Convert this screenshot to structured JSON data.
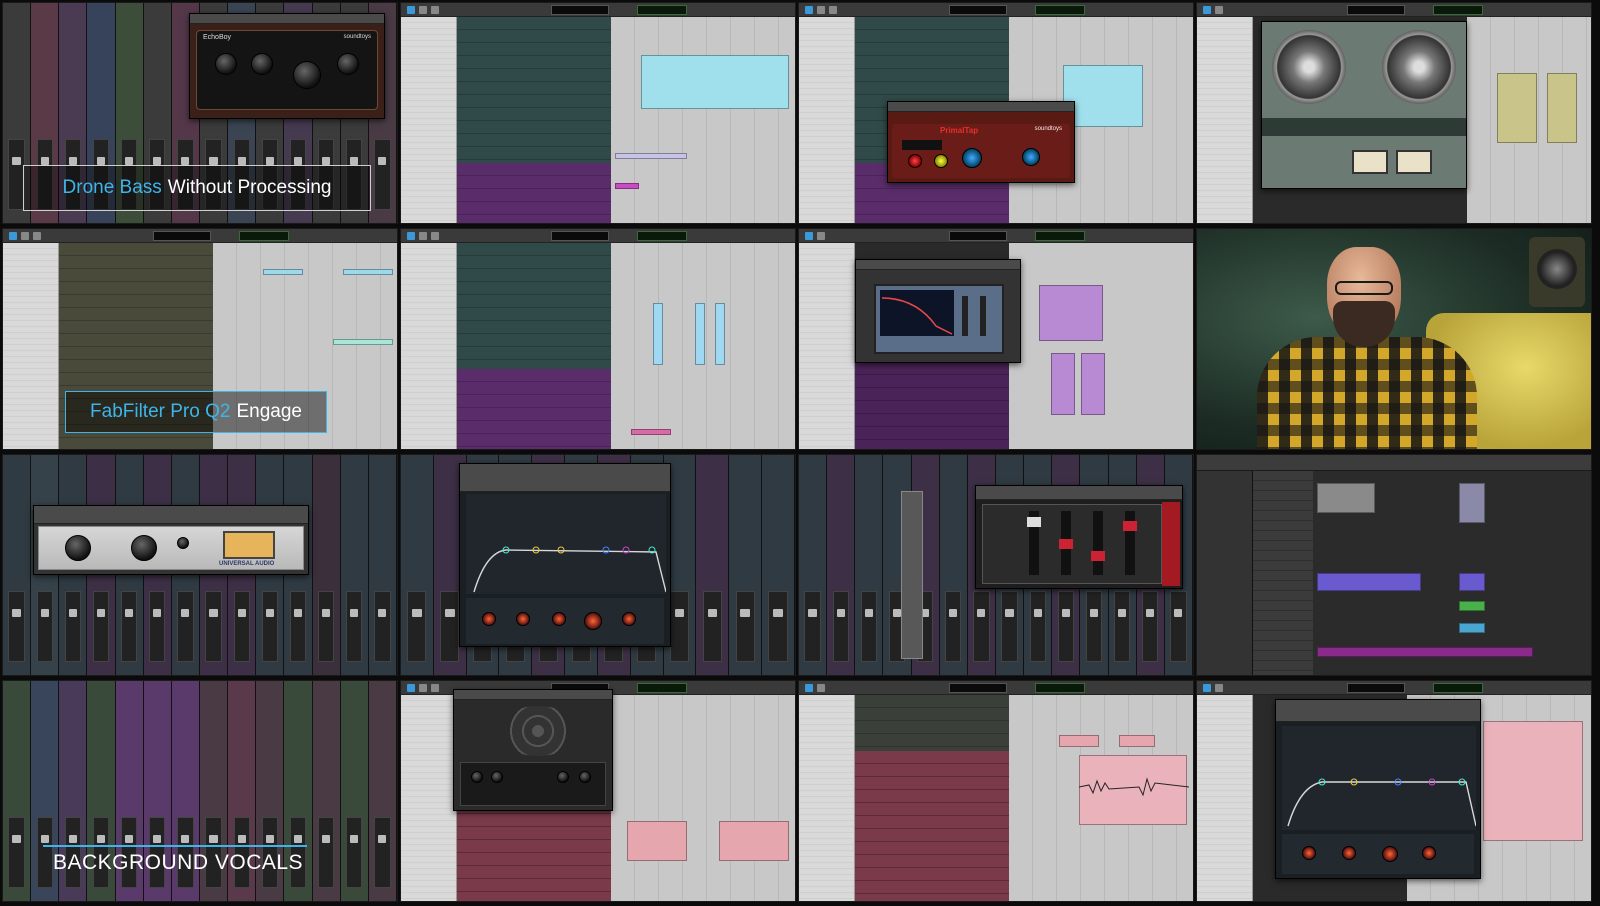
{
  "grid": {
    "rows": 4,
    "columns": 4
  },
  "captions": {
    "tile1": {
      "accent": "Drone Bass",
      "rest": "Without Processing"
    },
    "tile5": {
      "accent": "FabFilter Pro Q2",
      "rest": "Engage"
    },
    "tile13": {
      "text": "BACKGROUND VOCALS"
    }
  },
  "plugins": {
    "tile1": "EchoBoy",
    "tile3": "PrimalTap",
    "tile3_brand": "soundtoys",
    "tile1_brand": "soundtoys",
    "tile9_brand": "UNIVERSAL AUDIO"
  },
  "colors": {
    "caption_accent": "#3fb4e8",
    "caption_text": "#ffffff",
    "editor_bg": "#c8c8c8",
    "tracklist_bg": "#d9d9d9"
  }
}
